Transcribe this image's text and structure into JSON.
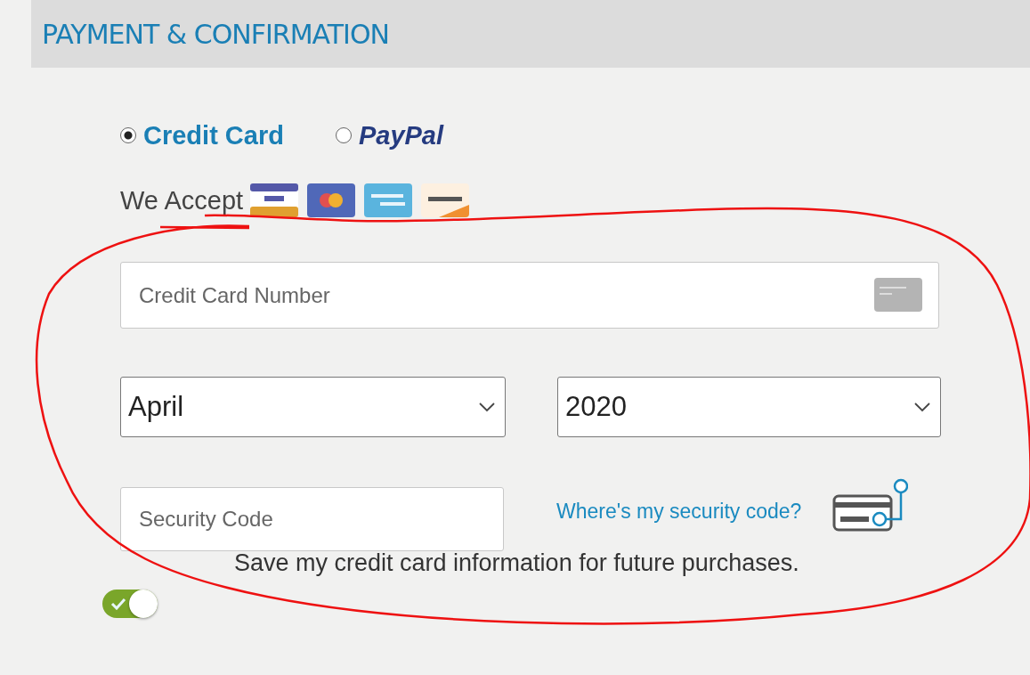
{
  "header": {
    "title": "PAYMENT & CONFIRMATION"
  },
  "payment_methods": [
    {
      "label": "Credit Card",
      "kind": "text",
      "selected": true
    },
    {
      "label": "PayPal",
      "kind": "logo",
      "selected": false
    }
  ],
  "accepted": {
    "label": "We Accept",
    "cards": [
      {
        "kind": "visa"
      },
      {
        "kind": "mastercard"
      },
      {
        "kind": "amex"
      },
      {
        "kind": "discover"
      }
    ]
  },
  "card_number": {
    "placeholder": "Credit Card Number"
  },
  "expiry_month": {
    "value": "April"
  },
  "expiry_year": {
    "value": "2020"
  },
  "security_code": {
    "placeholder": "Security Code"
  },
  "security_help_link": "Where's my security code?",
  "save_card": {
    "label": "Save my credit card information for future purchases.",
    "on": true
  }
}
